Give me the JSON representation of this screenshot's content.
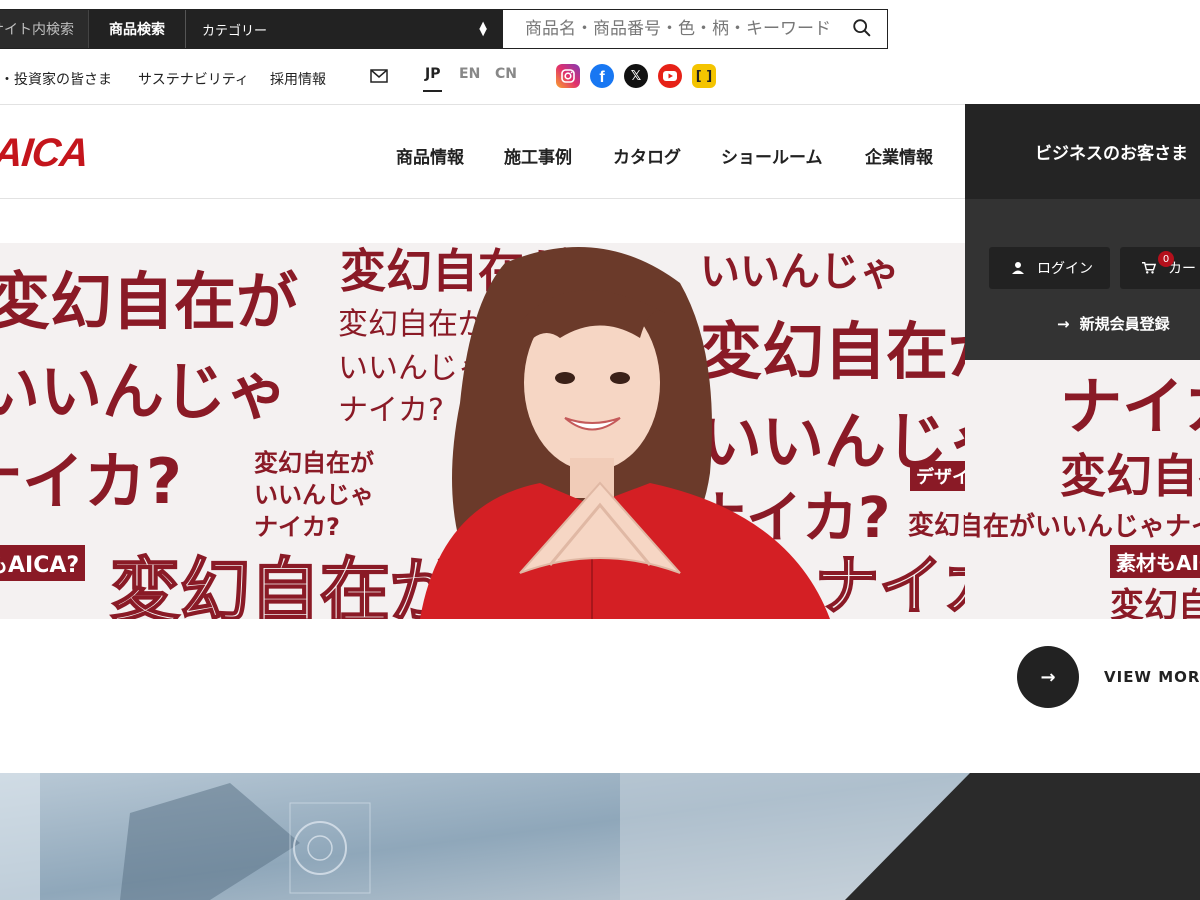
{
  "search": {
    "site_search_tab": "サイト内検索",
    "product_search_tab": "商品検索",
    "category_select": "カテゴリー",
    "placeholder": "商品名・商品番号・色・柄・キーワード"
  },
  "utility": {
    "investor_link": "株主・投資家の皆さま",
    "sustainability_link": "サステナビリティ",
    "recruit_link": "採用情報",
    "languages": [
      "JP",
      "EN",
      "CN"
    ],
    "active_language": "JP",
    "social_icons": [
      "instagram-icon",
      "facebook-icon",
      "x-icon",
      "youtube-icon",
      "kakaku-icon"
    ]
  },
  "header": {
    "logo": "AICA",
    "nav": [
      "商品情報",
      "施工事例",
      "カタログ",
      "ショールーム",
      "企業情報"
    ]
  },
  "business": {
    "title": "ビジネスのお客さま",
    "login_label": "ログイン",
    "cart_label": "カート",
    "cart_count": "0",
    "register_label": "新規会員登録"
  },
  "hero": {
    "slogan_big": "変幻自在が",
    "slogan_line2": "いいんじゃ",
    "slogan_line3": "ナイカ?",
    "slogan_full": "変幻自在がいいんじゃナイカ?",
    "tag_design": "デザインもAICA?",
    "tag_material": "素材もAICA?",
    "tag_aica": "もAICA?"
  },
  "view_more": {
    "label": "VIEW MORE"
  },
  "colors": {
    "brand_red": "#c4151c",
    "wall_red": "#8a1a26",
    "dark": "#222222"
  }
}
